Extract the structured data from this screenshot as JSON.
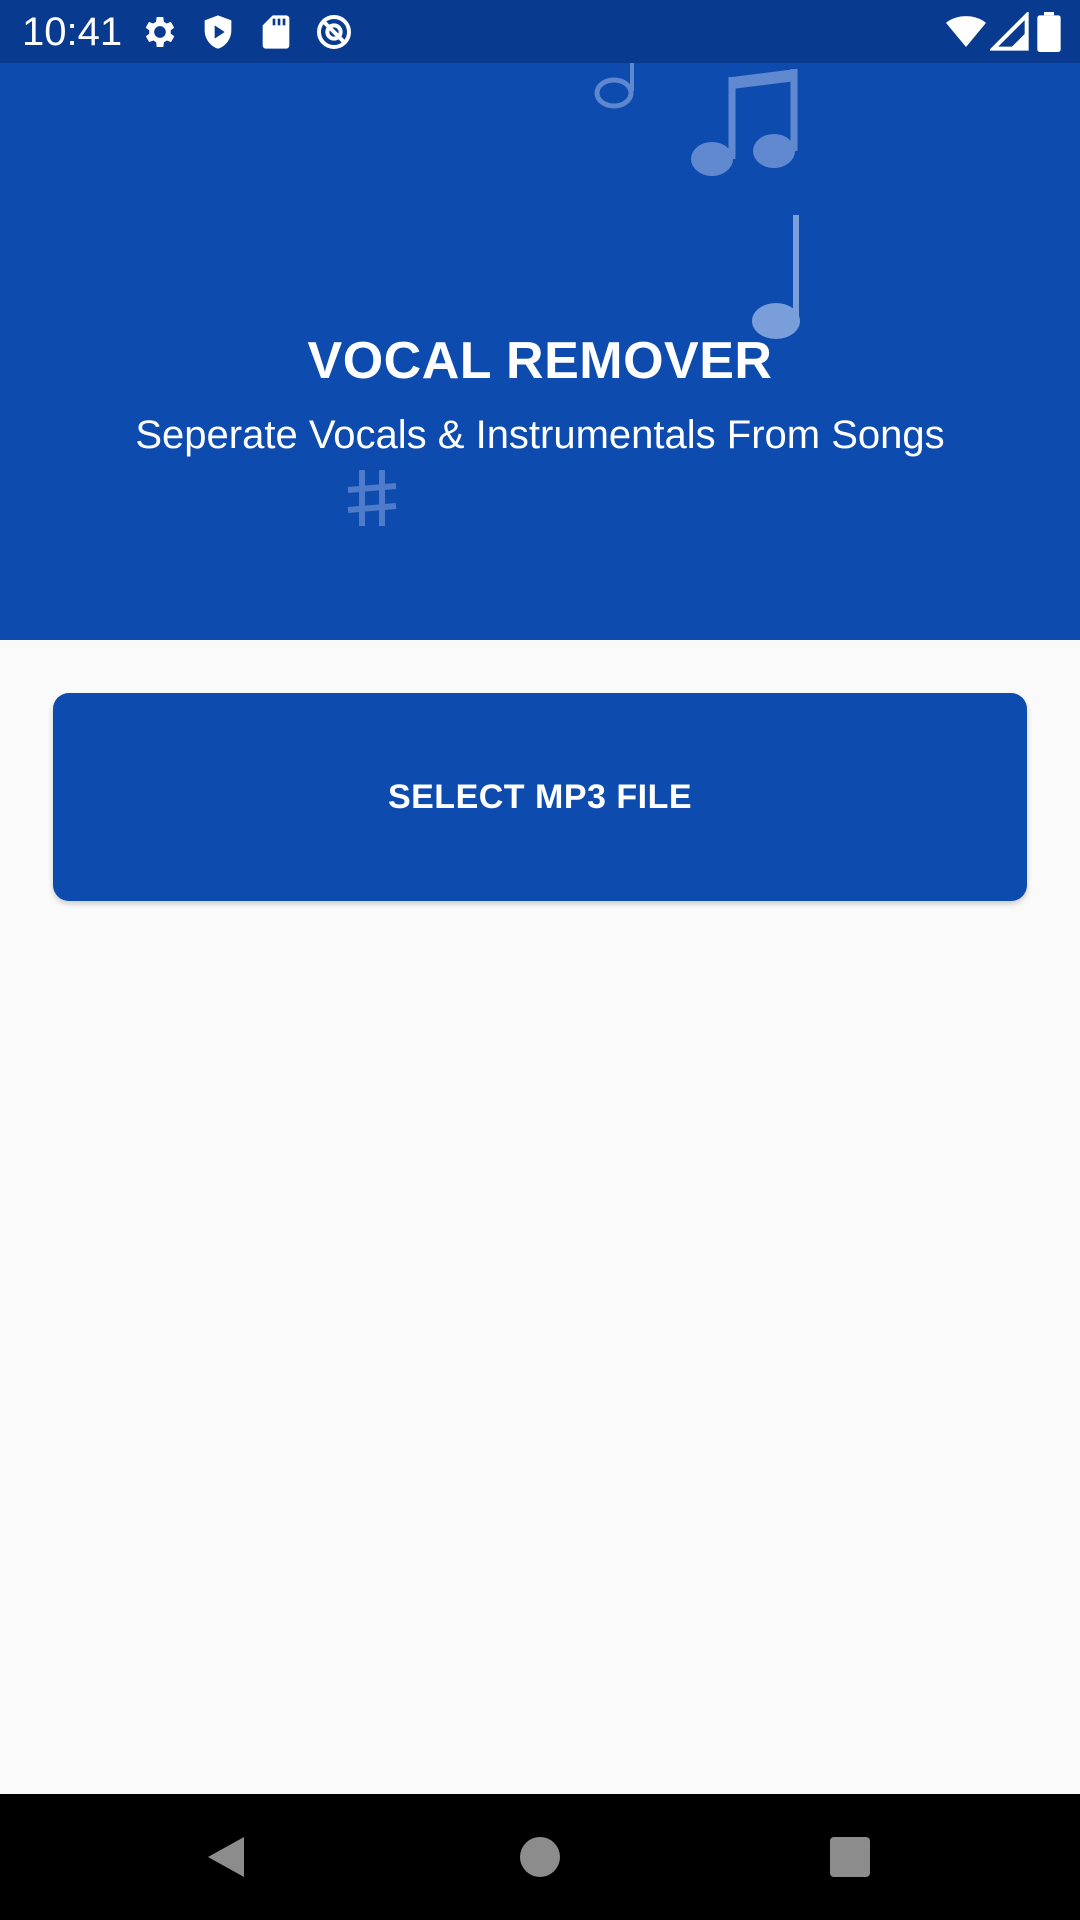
{
  "status_bar": {
    "time": "10:41",
    "left_icons": [
      "gear-icon",
      "shield-play-icon",
      "sd-card-icon",
      "at-sign-icon"
    ],
    "right_icons": [
      "wifi-icon",
      "signal-icon",
      "battery-icon"
    ]
  },
  "header": {
    "title": "VOCAL REMOVER",
    "subtitle": "Seperate Vocals & Instrumentals From Songs",
    "decorations": [
      "half-note-icon",
      "beamed-notes-icon",
      "quarter-note-icon",
      "sharp-sign-icon"
    ]
  },
  "main": {
    "select_button_label": "SELECT MP3 FILE"
  },
  "nav_bar": {
    "buttons": [
      "back-icon",
      "home-icon",
      "recents-icon"
    ]
  },
  "colors": {
    "status_bar": "#083a8f",
    "primary": "#0d4baf",
    "background": "#fafafa",
    "nav_bar": "#000000"
  }
}
